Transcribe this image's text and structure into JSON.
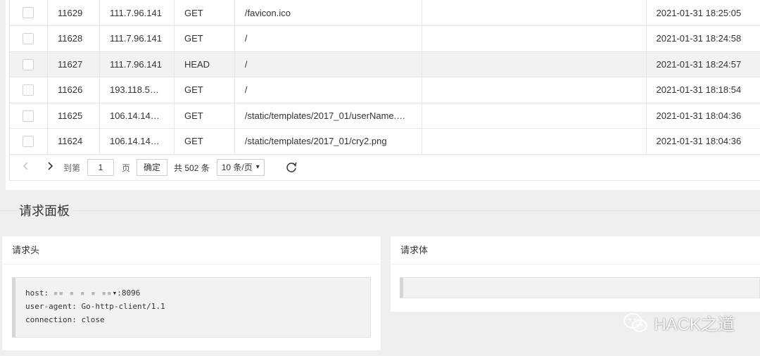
{
  "rows": [
    {
      "id": "11629",
      "ip": "111.7.96.141",
      "method": "GET",
      "path": "/favicon.ico",
      "time": "2021-01-31 18:25:05"
    },
    {
      "id": "11628",
      "ip": "111.7.96.141",
      "method": "GET",
      "path": "/",
      "time": "2021-01-31 18:24:58"
    },
    {
      "id": "11627",
      "ip": "111.7.96.141",
      "method": "HEAD",
      "path": "/",
      "time": "2021-01-31 18:24:57"
    },
    {
      "id": "11626",
      "ip": "193.118.5…",
      "method": "GET",
      "path": "/",
      "time": "2021-01-31 18:18:54"
    },
    {
      "id": "11625",
      "ip": "106.14.14…",
      "method": "GET",
      "path": "/static/templates/2017_01/userName.…",
      "time": "2021-01-31 18:04:36"
    },
    {
      "id": "11624",
      "ip": "106.14.14…",
      "method": "GET",
      "path": "/static/templates/2017_01/cry2.png",
      "time": "2021-01-31 18:04:36"
    }
  ],
  "pager": {
    "prev_icon": "chevron-left-icon",
    "next_icon": "chevron-right-icon",
    "goto_label": "到第",
    "page_value": "1",
    "page_unit": "页",
    "ok_label": "确定",
    "total_label": "共 502 条",
    "page_size": "10 条/页",
    "refresh_icon": "refresh-icon"
  },
  "section": {
    "title": "请求面板"
  },
  "request_header": {
    "title": "请求头",
    "host_label": "host: ",
    "host_masked": "▪▪  ▪ ▪ ▪ ▪▪",
    "host_port": "▾:8096",
    "user_agent": "user-agent: Go-http-client/1.1",
    "connection": "connection: close"
  },
  "request_body": {
    "title": "请求体",
    "content": ""
  },
  "watermark": {
    "text": "HACK之道",
    "icon": "wechat-icon"
  },
  "colors": {
    "page_bg": "#efefef",
    "hover_row": "#f2f2f2",
    "border": "#e6e6e6"
  }
}
